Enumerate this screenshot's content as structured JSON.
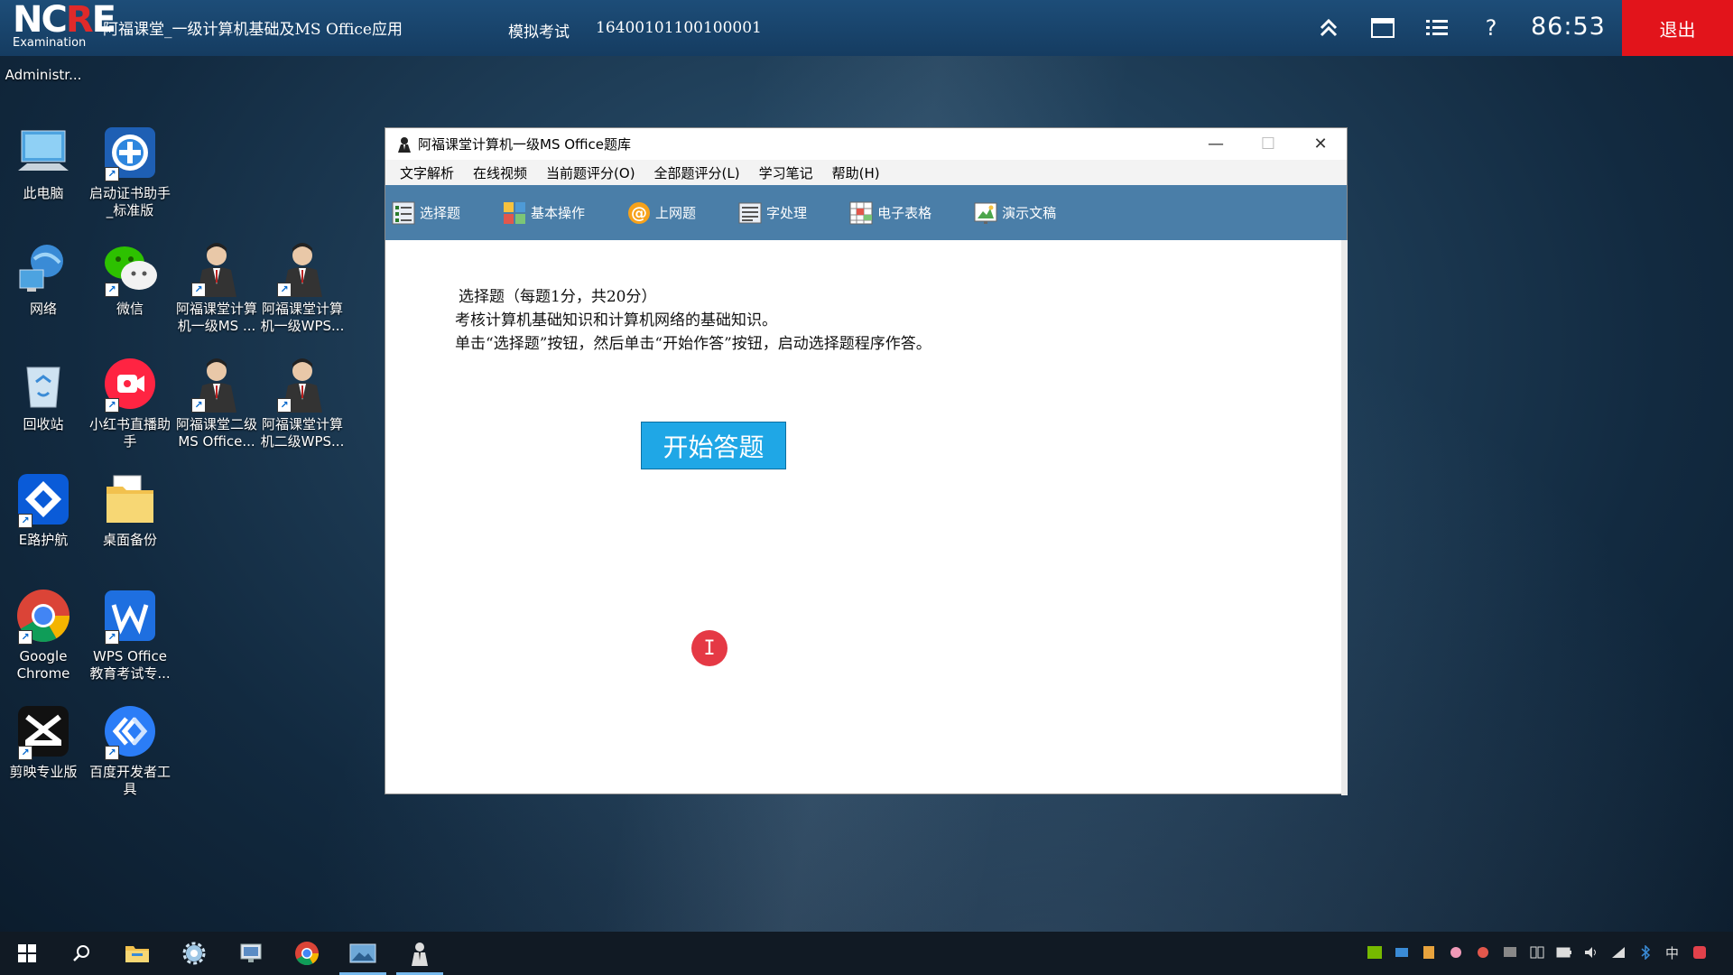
{
  "topbar": {
    "logo_text": "NCRE",
    "logo_sub": "Examination",
    "title": "阿福课堂_一级计算机基础及MS Office应用",
    "mode": "模拟考试",
    "exam_id": "16400101100100001",
    "timer": "86:53",
    "exit_label": "退出",
    "icons": [
      "collapse-up-icon",
      "window-icon",
      "list-icon",
      "help-icon"
    ],
    "exit_color": "#e2141b"
  },
  "desktop": {
    "admin_label": "Administr...",
    "icons": [
      {
        "label": "此电脑",
        "icon": "computer-icon"
      },
      {
        "label": "启动证书助手\n_标准版",
        "icon": "cert-assistant-icon"
      },
      {
        "label": "网络",
        "icon": "network-icon"
      },
      {
        "label": "微信",
        "icon": "wechat-icon"
      },
      {
        "label": "阿福课堂计算\n机一级MS ...",
        "icon": "teacher-avatar-icon"
      },
      {
        "label": "阿福课堂计算\n机一级WPS...",
        "icon": "teacher-avatar-icon"
      },
      {
        "label": "回收站",
        "icon": "recycle-bin-icon"
      },
      {
        "label": "小红书直播助\n手",
        "icon": "xiaohongshu-live-icon"
      },
      {
        "label": "阿福课堂二级\nMS Office...",
        "icon": "teacher-avatar-icon"
      },
      {
        "label": "阿福课堂计算\n机二级WPS...",
        "icon": "teacher-avatar-icon"
      },
      {
        "label": "E路护航",
        "icon": "e-road-icon"
      },
      {
        "label": "桌面备份",
        "icon": "folder-icon"
      },
      {
        "label": "Google\nChrome",
        "icon": "chrome-icon"
      },
      {
        "label": "WPS Office\n教育考试专...",
        "icon": "wps-icon"
      },
      {
        "label": "剪映专业版",
        "icon": "capcut-icon"
      },
      {
        "label": "百度开发者工\n具",
        "icon": "baidu-dev-icon"
      }
    ]
  },
  "window": {
    "title": "阿福课堂计算机一级MS Office题库",
    "controls": [
      "minimize-icon",
      "maximize-icon",
      "close-icon"
    ],
    "menu": [
      "文字解析",
      "在线视频",
      "当前题评分(O)",
      "全部题评分(L)",
      "学习笔记",
      "帮助(H)"
    ],
    "toolbar": [
      {
        "label": "选择题",
        "icon": "choice-icon"
      },
      {
        "label": "基本操作",
        "icon": "basic-op-icon"
      },
      {
        "label": "上网题",
        "icon": "at-icon"
      },
      {
        "label": "字处理",
        "icon": "word-icon"
      },
      {
        "label": "电子表格",
        "icon": "sheet-icon"
      },
      {
        "label": "演示文稿",
        "icon": "ppt-icon"
      }
    ],
    "content": {
      "line1": "选择题（每题1分，共20分）",
      "line2": "考核计算机基础知识和计算机网络的基础知识。",
      "line3": "单击“选择题”按钮，然后单击“开始作答”按钮，启动选择题程序作答。",
      "start_button": "开始答题",
      "cursor_glyph": "I"
    },
    "toolbar_color": "#4a7ea8",
    "start_button_color": "#1fa7e6"
  },
  "taskbar": {
    "items": [
      "windows-start-icon",
      "search-icon",
      "file-explorer-icon",
      "settings-gear-icon",
      "screen-tool-icon",
      "chrome-icon",
      "photo-app-icon",
      "exam-app-icon"
    ],
    "tray": [
      "nvidia-icon",
      "network-share-icon",
      "archive-icon",
      "flower-icon",
      "alert-icon",
      "display-icon",
      "window-tile-icon",
      "battery-icon",
      "volume-icon",
      "wifi-icon",
      "bluetooth-icon",
      "ime-icon",
      "wps-tray-icon"
    ],
    "ime_label": "中"
  }
}
